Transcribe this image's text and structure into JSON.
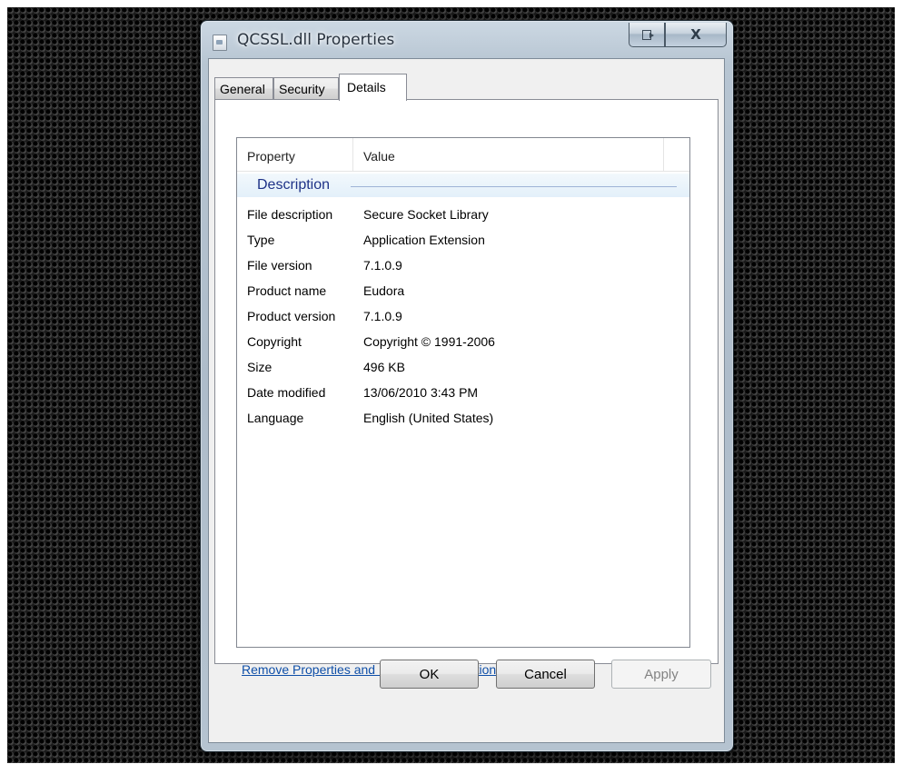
{
  "window": {
    "title": "QCSSL.dll Properties",
    "close_glyph": "X",
    "icons": {
      "app": "dll-file-icon",
      "help": "help-context-icon",
      "close": "close-icon"
    }
  },
  "tabs": [
    {
      "label": "General",
      "selected": false
    },
    {
      "label": "Security",
      "selected": false
    },
    {
      "label": "Details",
      "selected": true
    }
  ],
  "details": {
    "columns": {
      "property": "Property",
      "value": "Value"
    },
    "group": "Description",
    "rows": [
      {
        "property": "File description",
        "value": "Secure Socket Library"
      },
      {
        "property": "Type",
        "value": "Application Extension"
      },
      {
        "property": "File version",
        "value": "7.1.0.9"
      },
      {
        "property": "Product name",
        "value": "Eudora"
      },
      {
        "property": "Product version",
        "value": "7.1.0.9"
      },
      {
        "property": "Copyright",
        "value": "Copyright © 1991-2006"
      },
      {
        "property": "Size",
        "value": "496 KB"
      },
      {
        "property": "Date modified",
        "value": "13/06/2010 3:43 PM"
      },
      {
        "property": "Language",
        "value": "English (United States)"
      }
    ]
  },
  "link": {
    "label": "Remove Properties and Personal Information"
  },
  "buttons": {
    "ok": "OK",
    "cancel": "Cancel",
    "apply": "Apply",
    "apply_enabled": false
  },
  "colors": {
    "link": "#0f4fa8",
    "group_header_text": "#1e3287",
    "window_frame": "#b7c5d2",
    "dialog_background": "#f0f0f0"
  }
}
